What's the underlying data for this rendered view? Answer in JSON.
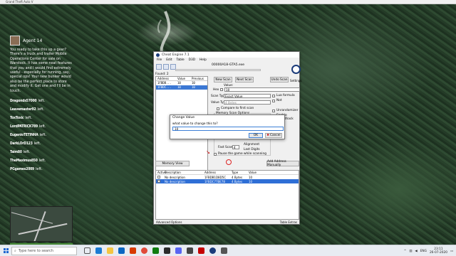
{
  "game": {
    "window_title": "Grand Theft Auto V"
  },
  "chat": {
    "agent_name": "Agent 14",
    "message": "You ready to take this up a gear? There's a truck and trailer Mobile Operations Center for sale on Warstock. It has some neat features that you and I would find extremely useful - especially for running, say, special ops! Your new bunker would also be the perfect place to store and modify it. Get one and I'll be in touch.",
    "feed": [
      {
        "player": "Dragonds57000",
        "action": "left."
      },
      {
        "player": "Leavemaster92",
        "action": "left."
      },
      {
        "player": "ToxToxic",
        "action": "left."
      },
      {
        "player": "LordPATRICK789",
        "action": "left."
      },
      {
        "player": "EugenioTETINHA",
        "action": "left."
      },
      {
        "player": "DarkLOrD123",
        "action": "left."
      },
      {
        "player": "Taim80",
        "action": "left."
      },
      {
        "player": "TheMaximus850",
        "action": "left."
      },
      {
        "player": "PGgames2009",
        "action": "left."
      }
    ]
  },
  "ce": {
    "title": "Cheat Engine 7.1",
    "menu": [
      "File",
      "Edit",
      "Table",
      "D3D",
      "Help"
    ],
    "process": "00000A18-GTA5.exe",
    "found": "Found: 2",
    "list_headers": [
      "Address",
      "Value",
      "Previous"
    ],
    "list_rows": [
      {
        "address": "1FBDB...",
        "value": "10",
        "previous": "10"
      },
      {
        "address": "1FBDC...",
        "value": "10",
        "previous": "10"
      }
    ],
    "new_scan": "New Scan",
    "next_scan": "Next Scan",
    "undo_scan": "Undo Scan",
    "settings": "Settings",
    "value_label": "Value:",
    "hex_label": "Hex",
    "value_input": "10",
    "scan_type_label": "Scan Type",
    "scan_type": "Exact Value",
    "value_type_label": "Value Type",
    "value_type": "4 Bytes",
    "compare_first": "Compare to first scan",
    "memory_options": "Memory Scan Options",
    "lua_formula": "Lua formula",
    "not_label": "Not",
    "unrandomizer": "Unrandomizer",
    "speedhack": "Enable Speedhack",
    "writable": "Writable",
    "executable": "Executable",
    "fast_scan": "Fast Scan",
    "fast_scan_val": "4",
    "alignment": "Alignment",
    "last_digits": "Last Digits",
    "pause_game": "Pause the game while scanning",
    "memory_view": "Memory View",
    "add_manual": "Add Address Manually",
    "addr_headers": [
      "Active",
      "Description",
      "Address",
      "Type",
      "Value"
    ],
    "addr_rows": [
      {
        "description": "No description",
        "address": "1FBDB1D8D5C",
        "type": "4 Bytes",
        "value": "10"
      },
      {
        "description": "No description",
        "address": "1FBDC77BE78",
        "type": "4 Bytes",
        "value": "10"
      }
    ],
    "advanced": "Advanced Options",
    "table_extras": "Table Extras"
  },
  "dialog": {
    "title": "Change Value",
    "prompt": "what value to change this to?",
    "input": "10",
    "ok": "OK",
    "cancel": "Cancel"
  },
  "taskbar": {
    "search_placeholder": "Type here to search",
    "lang": "ENG",
    "time": "23:11",
    "date": "26-07-2020"
  },
  "colors": {
    "selection": "#2f6fd6",
    "taskbar": "#e8ecf2"
  }
}
